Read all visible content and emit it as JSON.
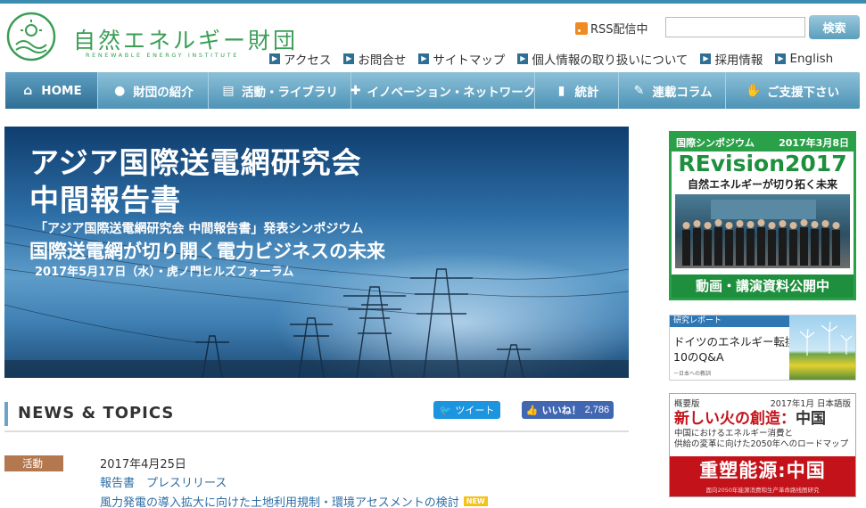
{
  "header": {
    "logo_title": "自然エネルギー財団",
    "logo_sub": "RENEWABLE ENERGY INSTITUTE",
    "rss_label": "RSS配信中",
    "search_placeholder": "",
    "search_button": "検索",
    "links": [
      {
        "label": "アクセス"
      },
      {
        "label": "お問合せ"
      },
      {
        "label": "サイトマップ"
      },
      {
        "label": "個人情報の取り扱いについて"
      },
      {
        "label": "採用情報"
      },
      {
        "label": "English"
      }
    ]
  },
  "nav": {
    "items": [
      {
        "label": "HOME",
        "icon": "home-icon"
      },
      {
        "label": "財団の紹介",
        "icon": "person-icon"
      },
      {
        "label": "活動・ライブラリ",
        "icon": "document-icon"
      },
      {
        "label": "イノベーション・ネットワーク",
        "icon": "network-icon"
      },
      {
        "label": "統計",
        "icon": "bar-chart-icon"
      },
      {
        "label": "連載コラム",
        "icon": "pen-icon"
      },
      {
        "label": "ご支援下さい",
        "icon": "handshake-icon"
      }
    ]
  },
  "hero": {
    "title_line1": "アジア国際送電網研究会",
    "title_line2": "中間報告書",
    "sub_line1": "「アジア国際送電網研究会 中間報告書」発表シンポジウム",
    "sub_line2": "国際送電網が切り開く電力ビジネスの未来",
    "sub_line3": "2017年5月17日（水）・虎ノ門ヒルズフォーラム"
  },
  "sidebar": {
    "banner1": {
      "head_left": "国際シンポジウム",
      "head_right": "2017年3月8日",
      "title": "REvision2017",
      "subtitle": "自然エネルギーが切り拓く未来",
      "footer": "動画・講演資料公開中"
    },
    "banner2": {
      "head": "研究レポート",
      "title_line1": "ドイツのエネルギー転換",
      "title_line2": "10のQ&A",
      "note": "ー日本への教訓"
    },
    "banner3": {
      "head_left": "概要版",
      "head_right": "2017年1月 日本語版",
      "title": "新しい火の創造：",
      "title_suffix": "中国",
      "desc_line1": "中国におけるエネルギー消費と",
      "desc_line2": "供給の変革に向けた2050年へのロードマップ",
      "red_title": "重塑能源:中国",
      "red_sub": "面向2050年能源消费和生产革命路线图研究"
    }
  },
  "news": {
    "heading": "NEWS & TOPICS",
    "tweet_label": "ツイート",
    "like_label": "いいね！",
    "like_count": "2,786",
    "items": [
      {
        "tag": "活動",
        "date": "2017年4月25日",
        "category": "報告書　プレスリリース",
        "title": "風力発電の導入拡大に向けた土地利用規制・環境アセスメントの検討",
        "badge": "NEW"
      }
    ]
  },
  "colors": {
    "accent": "#4e93b6",
    "logo_green": "#3a9e55",
    "tag_brown": "#b3784f",
    "link_blue": "#2d6ea6"
  }
}
